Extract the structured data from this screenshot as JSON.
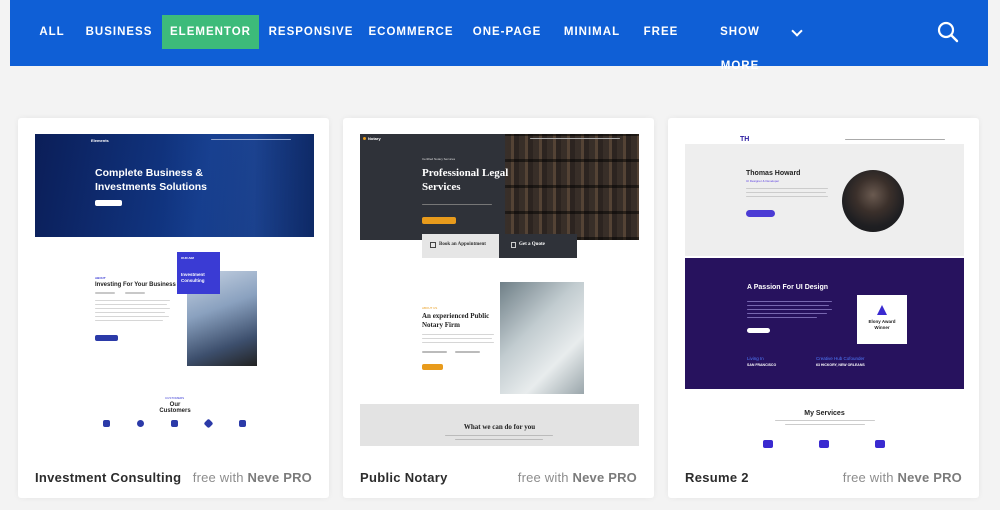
{
  "nav": {
    "items": [
      {
        "label": "ALL"
      },
      {
        "label": "BUSINESS"
      },
      {
        "label": "ELEMENTOR",
        "active": true
      },
      {
        "label": "RESPONSIVE"
      },
      {
        "label": "ECOMMERCE"
      },
      {
        "label": "ONE-PAGE"
      },
      {
        "label": "MINIMAL"
      },
      {
        "label": "FREE"
      },
      {
        "label": "SHOW MORE"
      }
    ],
    "colors": {
      "bar": "#0f5fd6",
      "active": "#3dbb7a"
    },
    "search_icon": "search-icon",
    "more_icon": "chevron-down-icon"
  },
  "cards": [
    {
      "title": "Investment Consulting",
      "price_prefix": "free with",
      "price_brand": "Neve PRO",
      "preview": {
        "brand": "Elements",
        "hero_title_1": "Complete Business &",
        "hero_title_2": "Investments Solutions",
        "section_title": "Investing For Your Business",
        "box_text_1": "Investment",
        "box_text_2": "Consulting",
        "customers_title": "Our Customers"
      }
    },
    {
      "title": "Public Notary",
      "price_prefix": "free with",
      "price_brand": "Neve PRO",
      "preview": {
        "brand": "Notary",
        "hero_title_1": "Professional Legal",
        "hero_title_2": "Services",
        "tab_1": "Book an Appointment",
        "tab_2": "Get a Quote",
        "section_title_1": "An experienced Public",
        "section_title_2": "Notary Firm",
        "bottom_title": "What we can do for you"
      }
    },
    {
      "title": "Resume 2",
      "price_prefix": "free with",
      "price_brand": "Neve PRO",
      "preview": {
        "logo": "TH",
        "name": "Thomas Howard",
        "role": "UI Designer & Developer",
        "passion_title": "A Passion For UI Design",
        "award_1": "Elony Award",
        "award_2": "Winner",
        "living_label": "Living In",
        "living_value": "SAN FRANCISCO",
        "creative_label": "Creative Hub Cofounder",
        "creative_value": "63 HICKORY, NEW ORLEANS",
        "services_title": "My Services"
      }
    }
  ]
}
